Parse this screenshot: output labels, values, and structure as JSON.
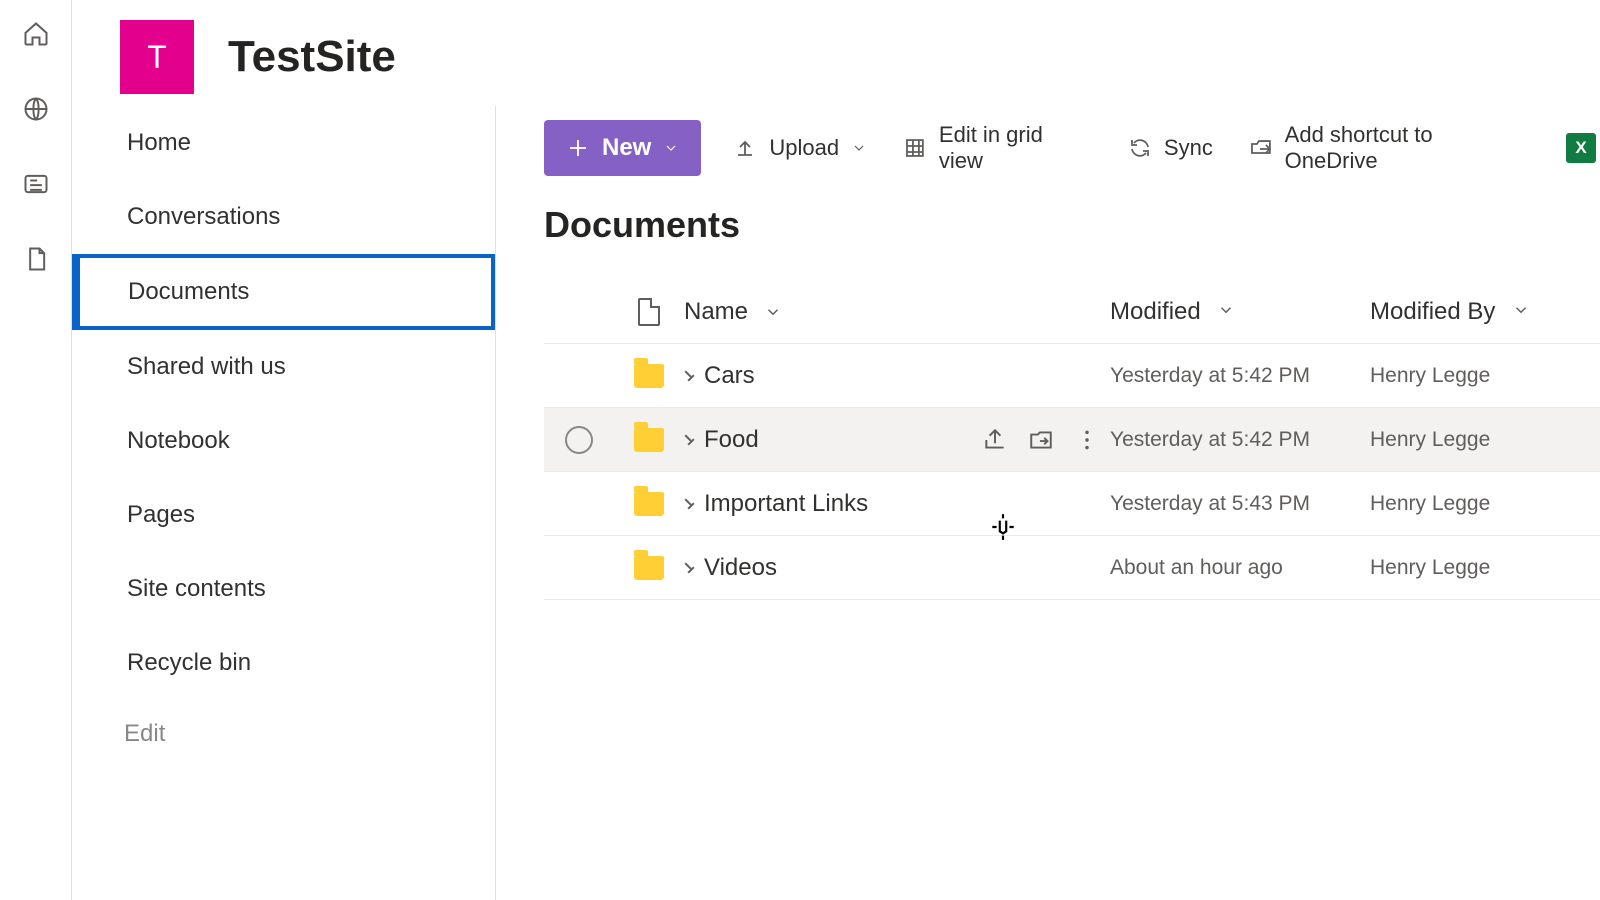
{
  "site": {
    "tileLetter": "T",
    "title": "TestSite"
  },
  "nav": {
    "items": [
      {
        "label": "Home",
        "selected": false
      },
      {
        "label": "Conversations",
        "selected": false
      },
      {
        "label": "Documents",
        "selected": true
      },
      {
        "label": "Shared with us",
        "selected": false
      },
      {
        "label": "Notebook",
        "selected": false
      },
      {
        "label": "Pages",
        "selected": false
      },
      {
        "label": "Site contents",
        "selected": false
      },
      {
        "label": "Recycle bin",
        "selected": false
      }
    ],
    "editLabel": "Edit"
  },
  "commands": {
    "new": "New",
    "upload": "Upload",
    "gridView": "Edit in grid view",
    "sync": "Sync",
    "shortcut": "Add shortcut to OneDrive",
    "excelTileLetter": "X"
  },
  "page": {
    "title": "Documents"
  },
  "columns": {
    "name": "Name",
    "modified": "Modified",
    "modifiedBy": "Modified By"
  },
  "rows": [
    {
      "name": "Cars",
      "modified": "Yesterday at 5:42 PM",
      "modifiedBy": "Henry Legge",
      "hover": false
    },
    {
      "name": "Food",
      "modified": "Yesterday at 5:42 PM",
      "modifiedBy": "Henry Legge",
      "hover": true
    },
    {
      "name": "Important Links",
      "modified": "Yesterday at 5:43 PM",
      "modifiedBy": "Henry Legge",
      "hover": false
    },
    {
      "name": "Videos",
      "modified": "About an hour ago",
      "modifiedBy": "Henry Legge",
      "hover": false
    }
  ]
}
